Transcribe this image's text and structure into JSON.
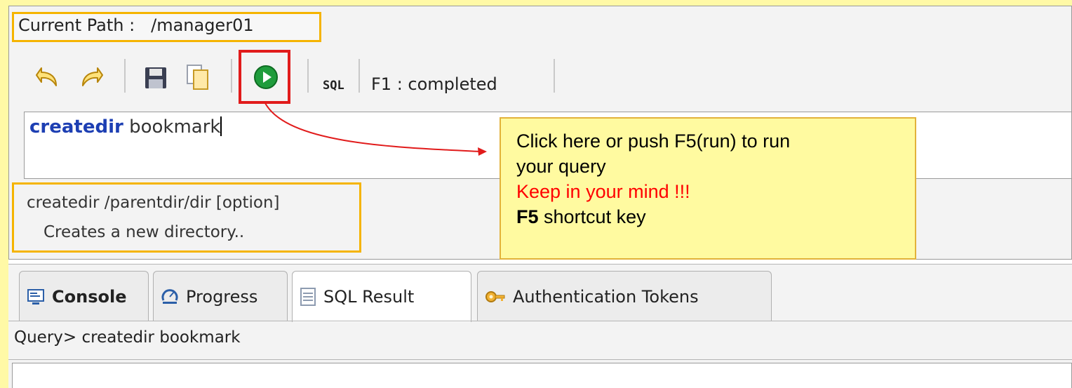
{
  "path_bar": {
    "label": "Current Path :",
    "value": "/manager01"
  },
  "toolbar": {
    "buttons": [
      {
        "icon": "undo-icon"
      },
      {
        "icon": "redo-icon"
      },
      {
        "icon": "save-icon"
      },
      {
        "icon": "copy-icon"
      },
      {
        "icon": "run-icon"
      }
    ],
    "sql_label": "SQL",
    "status": "F1 : completed"
  },
  "query": {
    "keyword": "createdir",
    "argument": "bookmark"
  },
  "help": {
    "syntax": "createdir /parentdir/dir [option]",
    "description": "Creates a new directory.."
  },
  "callout": {
    "line1": "Click here or push F5(run) to run",
    "line2": "your query",
    "warning": "Keep in your mind !!!",
    "key": "F5",
    "key_rest": "shortcut key"
  },
  "tabs": [
    {
      "label": "Console",
      "icon": "console-icon"
    },
    {
      "label": "Progress",
      "icon": "progress-icon"
    },
    {
      "label": "SQL Result",
      "icon": "table-icon"
    },
    {
      "label": "Authentication Tokens",
      "icon": "key-icon"
    }
  ],
  "result": {
    "text": "Query> createdir bookmark"
  },
  "colors": {
    "highlight": "#f5b400",
    "run_box": "#e11b1b",
    "callout_bg": "#fffaa0",
    "keyword": "#1d3fb3"
  }
}
